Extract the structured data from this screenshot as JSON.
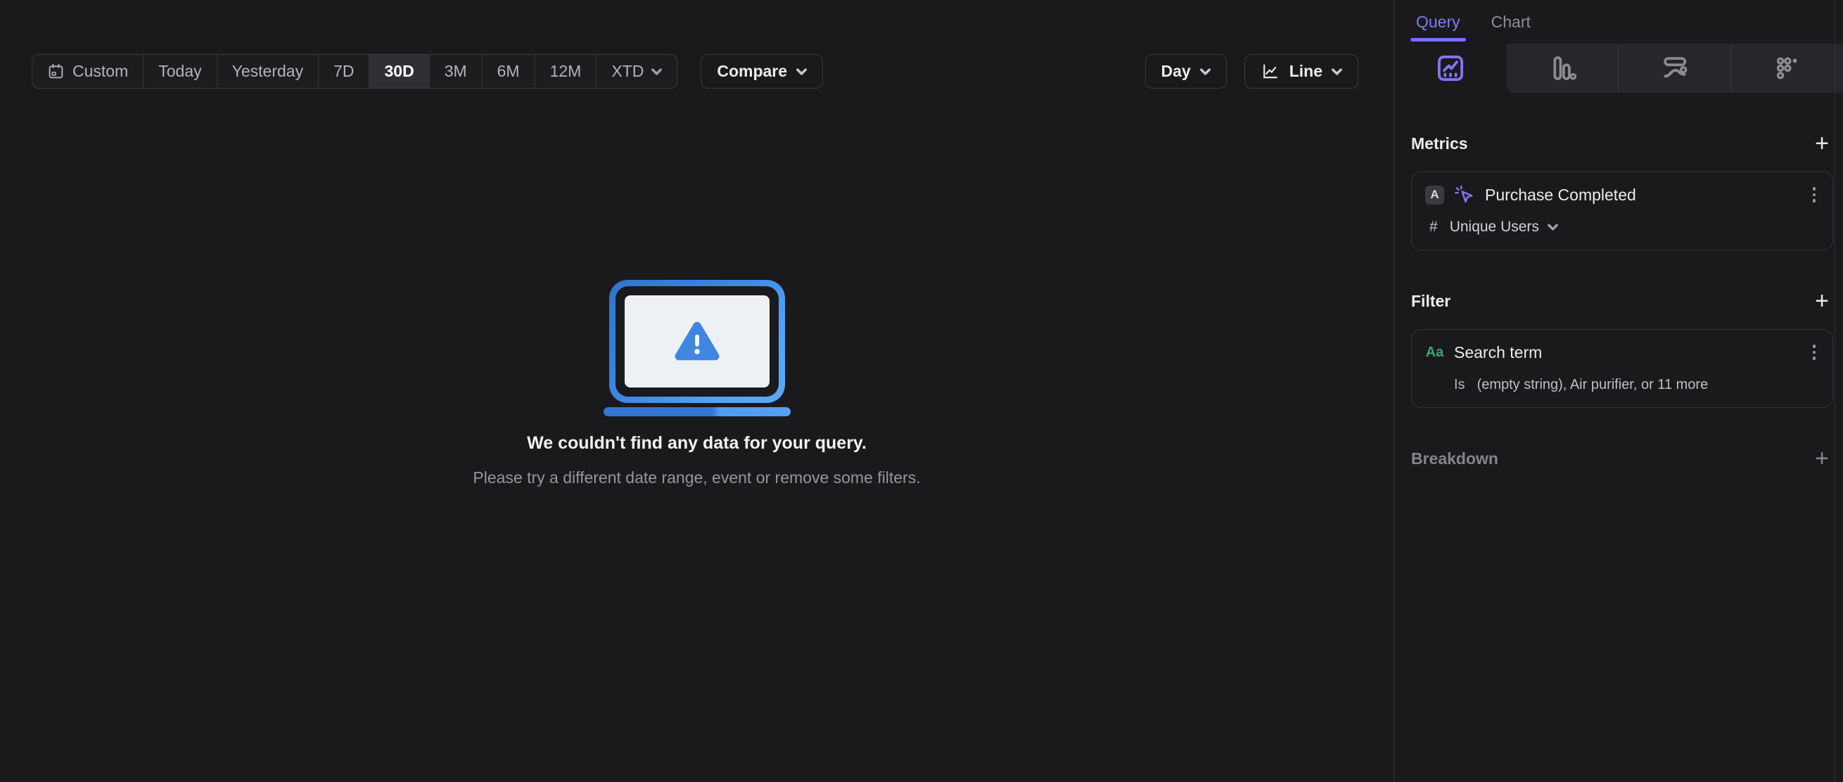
{
  "toolbar": {
    "date_ranges": [
      "Custom",
      "Today",
      "Yesterday",
      "7D",
      "30D",
      "3M",
      "6M",
      "12M",
      "XTD"
    ],
    "selected_range": "30D",
    "compare_label": "Compare",
    "granularity_label": "Day",
    "chart_style_label": "Line"
  },
  "empty_state": {
    "title": "We couldn't find any data for your query.",
    "subtitle": "Please try a different date range, event or remove some filters."
  },
  "sidebar": {
    "tabs": [
      {
        "label": "Query",
        "active": true
      },
      {
        "label": "Chart",
        "active": false
      }
    ],
    "metrics": {
      "heading": "Metrics",
      "add_label": "+",
      "items": [
        {
          "letter": "A",
          "event": "Purchase Completed",
          "agg_prefix": "#",
          "aggregation": "Unique Users"
        }
      ]
    },
    "filter": {
      "heading": "Filter",
      "add_label": "+",
      "items": [
        {
          "type_label": "Aa",
          "property": "Search term",
          "operator": "Is",
          "value": "(empty string), Air purifier, or 11 more"
        }
      ]
    },
    "breakdown": {
      "heading": "Breakdown",
      "add_label": "+"
    }
  },
  "colors": {
    "accent_purple": "#7d72f2",
    "accent_blue": "#4292ec",
    "accent_green": "#41a173",
    "background": "#1a1a1d"
  }
}
